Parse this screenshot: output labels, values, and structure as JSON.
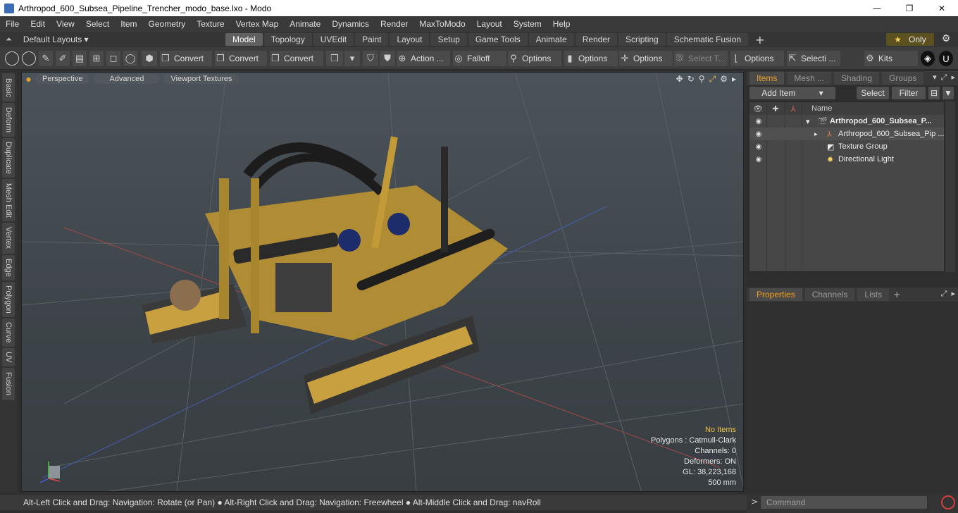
{
  "window": {
    "title": "Arthropod_600_Subsea_Pipeline_Trencher_modo_base.lxo - Modo",
    "minimize": "—",
    "maximize": "❐",
    "close": "✕"
  },
  "menu": [
    "File",
    "Edit",
    "View",
    "Select",
    "Item",
    "Geometry",
    "Texture",
    "Vertex Map",
    "Animate",
    "Dynamics",
    "Render",
    "MaxToModo",
    "Layout",
    "System",
    "Help"
  ],
  "layouts": {
    "label": "Default Layouts ▾"
  },
  "tabs": [
    {
      "label": "Model",
      "active": true
    },
    {
      "label": "Topology"
    },
    {
      "label": "UVEdit"
    },
    {
      "label": "Paint"
    },
    {
      "label": "Layout"
    },
    {
      "label": "Setup"
    },
    {
      "label": "Game Tools"
    },
    {
      "label": "Animate"
    },
    {
      "label": "Render"
    },
    {
      "label": "Scripting"
    },
    {
      "label": "Schematic Fusion"
    }
  ],
  "only_button": {
    "star": "★",
    "label": "Only"
  },
  "toolbar": {
    "convert1": "Convert",
    "convert2": "Convert",
    "convert3": "Convert",
    "action": "Action ...",
    "falloff": "Falloff",
    "options1": "Options",
    "options2": "Options",
    "options3": "Options",
    "select_t": "Select T...",
    "options4": "Options",
    "selecti": "Selecti ...",
    "kits": "Kits"
  },
  "left_tabs": [
    "Basic",
    "Deform",
    "Duplicate",
    "Mesh Edit",
    "Vertex",
    "Edge",
    "Polygon",
    "Curve",
    "UV",
    "Fusion"
  ],
  "viewport": {
    "view_mode": "Perspective",
    "advanced": "Advanced",
    "textures": "Viewport Textures"
  },
  "stats": {
    "no_items": "No Items",
    "polygons": "Polygons : Catmull-Clark",
    "channels": "Channels: 0",
    "deformers": "Deformers: ON",
    "gl": "GL: 38,223,168",
    "scale": "500 mm"
  },
  "items_panel": {
    "tabs": [
      "Items",
      "Mesh ...",
      "Shading",
      "Groups"
    ],
    "add_item": "Add Item",
    "select": "Select",
    "filter": "Filter",
    "name_header": "Name",
    "rows": [
      {
        "label": "Arthropod_600_Subsea_P...",
        "icon": "scene-icon"
      },
      {
        "label": "Arthropod_600_Subsea_Pip ...",
        "icon": "mesh-icon"
      },
      {
        "label": "Texture Group",
        "icon": "texture-icon"
      },
      {
        "label": "Directional Light",
        "icon": "light-icon"
      }
    ]
  },
  "properties_panel": {
    "tabs": [
      "Properties",
      "Channels",
      "Lists"
    ]
  },
  "statusbar": {
    "text": "Alt-Left Click and Drag: Navigation: Rotate (or Pan) ● Alt-Right Click and Drag: Navigation: Freewheel ● Alt-Middle Click and Drag: navRoll"
  },
  "command": {
    "placeholder": "Command"
  }
}
